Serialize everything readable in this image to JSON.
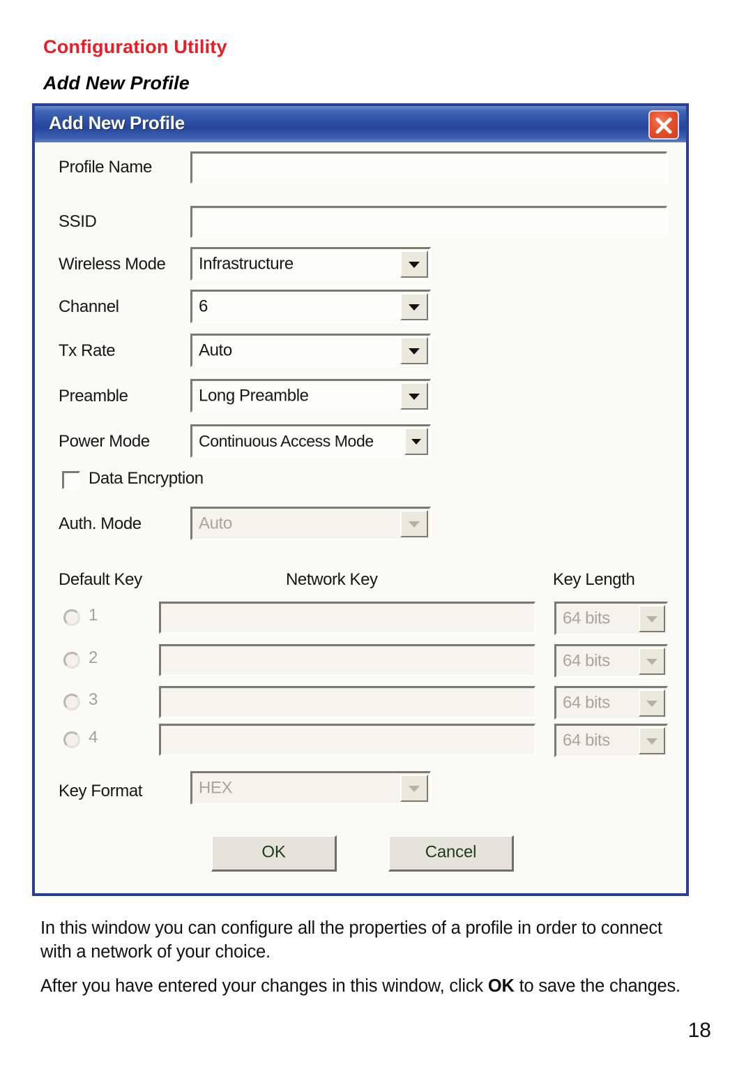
{
  "page": {
    "title": "Configuration Utility",
    "subtitle": "Add New Profile",
    "number": "18",
    "accent_color": "#ee1c25",
    "titlebar_color": "#2e4fa6"
  },
  "dialog": {
    "title": "Add New Profile",
    "close_icon": "close-x-icon",
    "fields": {
      "profile_name": {
        "label": "Profile Name",
        "value": ""
      },
      "ssid": {
        "label": "SSID",
        "value": ""
      },
      "wireless_mode": {
        "label": "Wireless Mode",
        "value": "Infrastructure"
      },
      "channel": {
        "label": "Channel",
        "value": "6"
      },
      "tx_rate": {
        "label": "Tx Rate",
        "value": "Auto"
      },
      "preamble": {
        "label": "Preamble",
        "value": "Long Preamble"
      },
      "power_mode": {
        "label": "Power Mode",
        "value": "Continuous Access Mode"
      },
      "data_encryption": {
        "label": "Data Encryption",
        "checked": false
      },
      "auth_mode": {
        "label": "Auth. Mode",
        "value": "Auto",
        "disabled": true
      },
      "key_format": {
        "label": "Key Format",
        "value": "HEX",
        "disabled": true
      }
    },
    "key_table": {
      "headers": {
        "default_key": "Default Key",
        "network_key": "Network Key",
        "key_length": "Key Length"
      },
      "rows": [
        {
          "index": "1",
          "selected": false,
          "network_key": "",
          "key_length": "64 bits"
        },
        {
          "index": "2",
          "selected": false,
          "network_key": "",
          "key_length": "64 bits"
        },
        {
          "index": "3",
          "selected": false,
          "network_key": "",
          "key_length": "64 bits"
        },
        {
          "index": "4",
          "selected": false,
          "network_key": "",
          "key_length": "64 bits"
        }
      ]
    },
    "buttons": {
      "ok": "OK",
      "cancel": "Cancel"
    }
  },
  "footer": {
    "paragraph1": "In this window you can configure all the properties of a profile in order to connect with a network of your choice.",
    "paragraph2_part1": "After you have entered your changes in this window, click ",
    "paragraph2_bold": "OK",
    "paragraph2_part2": " to save the changes."
  }
}
